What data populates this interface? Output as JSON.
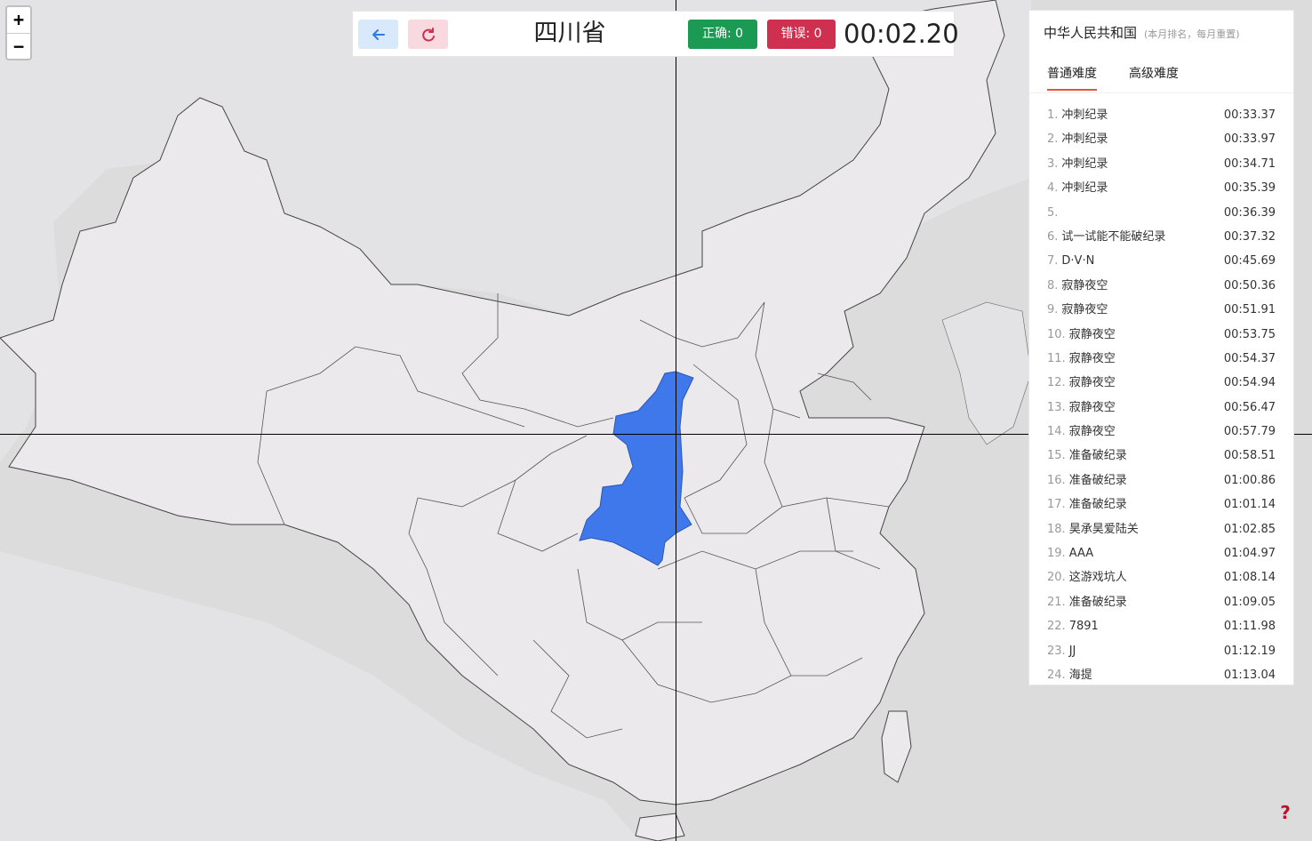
{
  "zoom": {
    "in_label": "+",
    "out_label": "−"
  },
  "topbar": {
    "back_icon": "arrow-left-icon",
    "reset_icon": "refresh-icon",
    "target_province": "四川省",
    "correct_label": "正确: 0",
    "wrong_label": "错误: 0",
    "timer": "00:02.20"
  },
  "colors": {
    "highlight": "#3f78ea",
    "province_fill": "#ebe9ec",
    "sea": "#dcdcdc",
    "correct_badge": "#1a9a52",
    "wrong_badge": "#d0304f"
  },
  "leaderboard": {
    "title": "中华人民共和国",
    "note": "(本月排名，每月重置)",
    "tabs": [
      "普通难度",
      "高级难度"
    ],
    "active_tab": 0,
    "rows": [
      {
        "rank": "1.",
        "name": "冲刺纪录",
        "time": "00:33.37"
      },
      {
        "rank": "2.",
        "name": "冲刺纪录",
        "time": "00:33.97"
      },
      {
        "rank": "3.",
        "name": "冲刺纪录",
        "time": "00:34.71"
      },
      {
        "rank": "4.",
        "name": "冲刺纪录",
        "time": "00:35.39"
      },
      {
        "rank": "5.",
        "name": "",
        "time": "00:36.39"
      },
      {
        "rank": "6.",
        "name": "试一试能不能破纪录",
        "time": "00:37.32"
      },
      {
        "rank": "7.",
        "name": "D·V·N",
        "time": "00:45.69"
      },
      {
        "rank": "8.",
        "name": "寂静夜空",
        "time": "00:50.36"
      },
      {
        "rank": "9.",
        "name": "寂静夜空",
        "time": "00:51.91"
      },
      {
        "rank": "10.",
        "name": "寂静夜空",
        "time": "00:53.75"
      },
      {
        "rank": "11.",
        "name": "寂静夜空",
        "time": "00:54.37"
      },
      {
        "rank": "12.",
        "name": "寂静夜空",
        "time": "00:54.94"
      },
      {
        "rank": "13.",
        "name": "寂静夜空",
        "time": "00:56.47"
      },
      {
        "rank": "14.",
        "name": "寂静夜空",
        "time": "00:57.79"
      },
      {
        "rank": "15.",
        "name": "准备破纪录",
        "time": "00:58.51"
      },
      {
        "rank": "16.",
        "name": "准备破纪录",
        "time": "01:00.86"
      },
      {
        "rank": "17.",
        "name": "准备破纪录",
        "time": "01:01.14"
      },
      {
        "rank": "18.",
        "name": "昊承昊爱陆关",
        "time": "01:02.85"
      },
      {
        "rank": "19.",
        "name": "AAA",
        "time": "01:04.97"
      },
      {
        "rank": "20.",
        "name": "这游戏坑人",
        "time": "01:08.14"
      },
      {
        "rank": "21.",
        "name": "准备破纪录",
        "time": "01:09.05"
      },
      {
        "rank": "22.",
        "name": "7891",
        "time": "01:11.98"
      },
      {
        "rank": "23.",
        "name": "JJ",
        "time": "01:12.19"
      },
      {
        "rank": "24.",
        "name": "海提",
        "time": "01:13.04"
      }
    ]
  },
  "help_label": "?"
}
